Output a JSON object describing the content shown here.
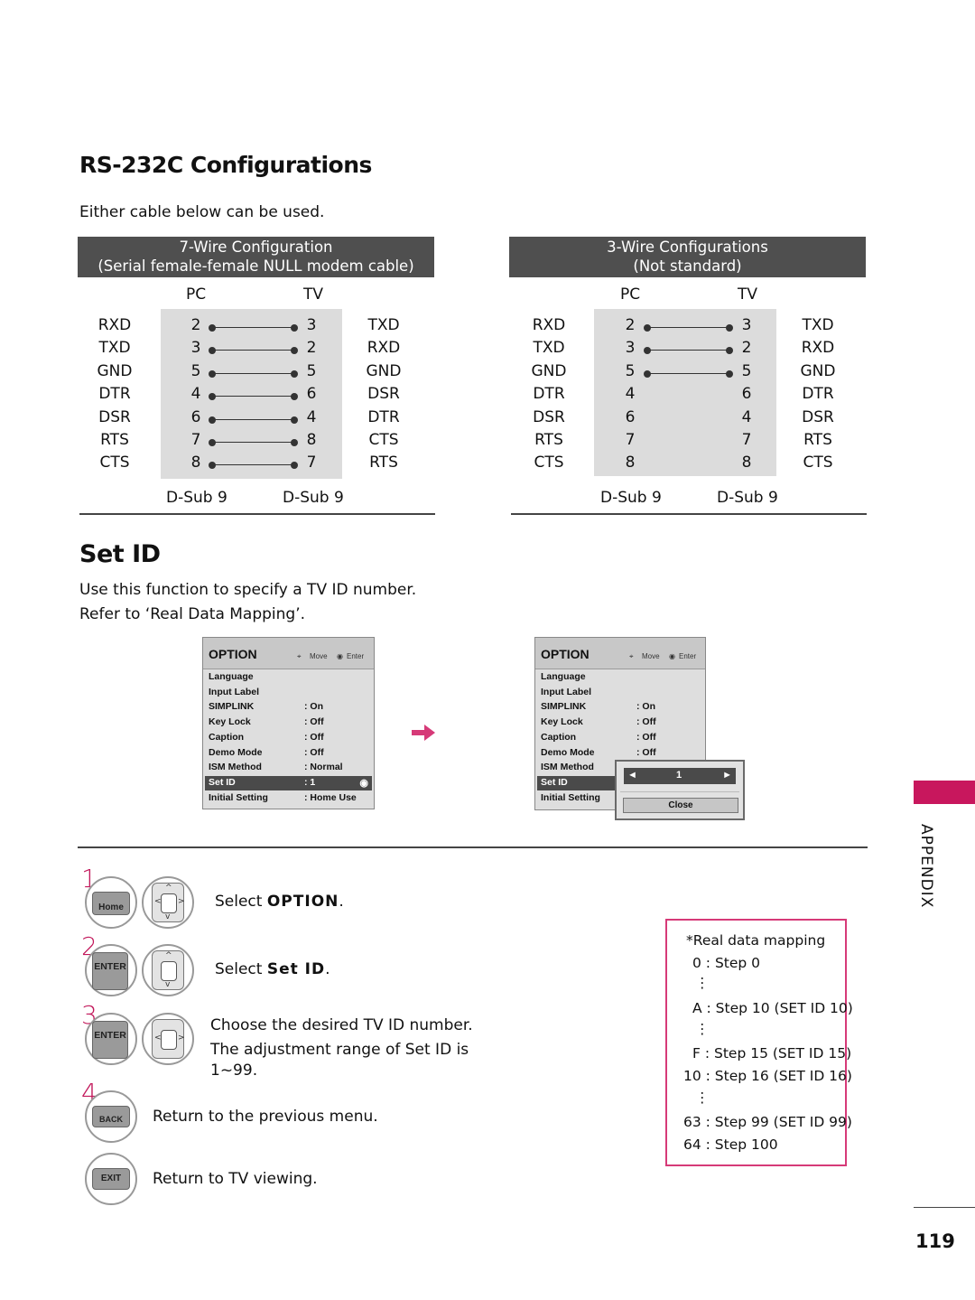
{
  "rs232": {
    "title": "RS-232C Configurations",
    "intro": "Either cable below can be used.",
    "seven_wire": {
      "header_line1": "7-Wire Configuration",
      "header_line2": "(Serial female-female NULL modem cable)",
      "pc_label": "PC",
      "tv_label": "TV",
      "rows": [
        {
          "pc_signal": "RXD",
          "pc_pin": "2",
          "tv_pin": "3",
          "tv_signal": "TXD",
          "connected": true
        },
        {
          "pc_signal": "TXD",
          "pc_pin": "3",
          "tv_pin": "2",
          "tv_signal": "RXD",
          "connected": true
        },
        {
          "pc_signal": "GND",
          "pc_pin": "5",
          "tv_pin": "5",
          "tv_signal": "GND",
          "connected": true
        },
        {
          "pc_signal": "DTR",
          "pc_pin": "4",
          "tv_pin": "6",
          "tv_signal": "DSR",
          "connected": true
        },
        {
          "pc_signal": "DSR",
          "pc_pin": "6",
          "tv_pin": "4",
          "tv_signal": "DTR",
          "connected": true
        },
        {
          "pc_signal": "RTS",
          "pc_pin": "7",
          "tv_pin": "8",
          "tv_signal": "CTS",
          "connected": true
        },
        {
          "pc_signal": "CTS",
          "pc_pin": "8",
          "tv_pin": "7",
          "tv_signal": "RTS",
          "connected": true
        }
      ],
      "pc_connector": "D-Sub 9",
      "tv_connector": "D-Sub 9"
    },
    "three_wire": {
      "header_line1": "3-Wire Configurations",
      "header_line2": "(Not standard)",
      "pc_label": "PC",
      "tv_label": "TV",
      "rows": [
        {
          "pc_signal": "RXD",
          "pc_pin": "2",
          "tv_pin": "3",
          "tv_signal": "TXD",
          "connected": true
        },
        {
          "pc_signal": "TXD",
          "pc_pin": "3",
          "tv_pin": "2",
          "tv_signal": "RXD",
          "connected": true
        },
        {
          "pc_signal": "GND",
          "pc_pin": "5",
          "tv_pin": "5",
          "tv_signal": "GND",
          "connected": true
        },
        {
          "pc_signal": "DTR",
          "pc_pin": "4",
          "tv_pin": "6",
          "tv_signal": "DTR",
          "connected": false
        },
        {
          "pc_signal": "DSR",
          "pc_pin": "6",
          "tv_pin": "4",
          "tv_signal": "DSR",
          "connected": false
        },
        {
          "pc_signal": "RTS",
          "pc_pin": "7",
          "tv_pin": "7",
          "tv_signal": "RTS",
          "connected": false
        },
        {
          "pc_signal": "CTS",
          "pc_pin": "8",
          "tv_pin": "8",
          "tv_signal": "CTS",
          "connected": false
        }
      ],
      "pc_connector": "D-Sub 9",
      "tv_connector": "D-Sub 9"
    }
  },
  "setid": {
    "title": "Set ID",
    "desc1": "Use this function to specify a TV ID number.",
    "desc2": "Refer to ‘Real Data Mapping’."
  },
  "menu": {
    "title": "OPTION",
    "hint_move": "Move",
    "hint_enter": "Enter",
    "items": [
      {
        "key": "Language",
        "value": ""
      },
      {
        "key": "Input Label",
        "value": ""
      },
      {
        "key": "SIMPLINK",
        "value": ": On"
      },
      {
        "key": "Key Lock",
        "value": ": Off"
      },
      {
        "key": "Caption",
        "value": ": Off"
      },
      {
        "key": "Demo Mode",
        "value": ": Off"
      },
      {
        "key": "ISM Method",
        "value": ": Normal"
      },
      {
        "key": "Set ID",
        "value": ": 1"
      },
      {
        "key": "Initial Setting",
        "value": ": Home Use"
      }
    ],
    "selected_index": 7,
    "popup": {
      "value": "1",
      "close_label": "Close",
      "left_arrow": "◄",
      "right_arrow": "►"
    }
  },
  "steps": [
    {
      "num": "1",
      "key1": "Home",
      "text_prefix": "Select ",
      "text_bold": "OPTION",
      "text_suffix": "."
    },
    {
      "num": "2",
      "key1": "ENTER",
      "text_prefix": "Select ",
      "text_bold": "Set ID",
      "text_suffix": "."
    },
    {
      "num": "3",
      "key1": "ENTER",
      "line1": "Choose the desired TV ID number.",
      "line2": "The adjustment range of Set ID is",
      "line3": "1~99."
    },
    {
      "num": "4",
      "key1": "BACK",
      "text": "Return to the previous menu."
    },
    {
      "num": "",
      "key1": "EXIT",
      "text": "Return to TV viewing."
    }
  ],
  "mapping": {
    "title": "*Real data mapping",
    "lines": [
      "0 : Step 0",
      "⋮",
      "A : Step 10 (SET ID 10)",
      "⋮",
      "F : Step 15 (SET ID 15)",
      "10 : Step 16 (SET ID 16)",
      "⋮",
      "63 : Step 99 (SET ID 99)",
      "64 : Step 100"
    ]
  },
  "side_tab": "APPENDIX",
  "page_number": "119",
  "colors": {
    "accent": "#c8175d",
    "header_bg": "#4f4f4f",
    "pin_bg": "#dcdcdc",
    "map_border": "#d63a78"
  }
}
